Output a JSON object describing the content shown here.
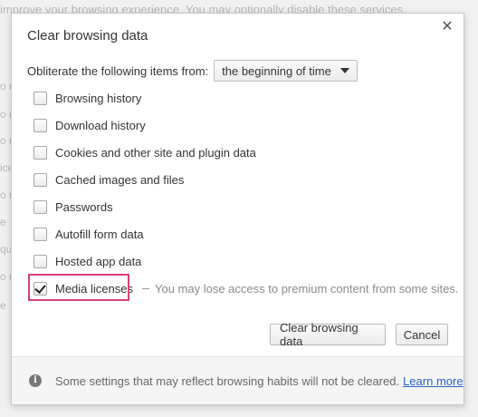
{
  "background": {
    "top_text": "improve your browsing experience. You may optionally disable these services.",
    "fragments": [
      "o r",
      "o r",
      "o r",
      "ice",
      "o r",
      "e",
      "qu",
      "o r",
      "e"
    ]
  },
  "dialog": {
    "title": "Clear browsing data",
    "close_icon": "close-icon",
    "timerange": {
      "label": "Obliterate the following items from:",
      "selected": "the beginning of time"
    },
    "items": [
      {
        "label": "Browsing history",
        "checked": false
      },
      {
        "label": "Download history",
        "checked": false
      },
      {
        "label": "Cookies and other site and plugin data",
        "checked": false
      },
      {
        "label": "Cached images and files",
        "checked": false
      },
      {
        "label": "Passwords",
        "checked": false
      },
      {
        "label": "Autofill form data",
        "checked": false
      },
      {
        "label": "Hosted app data",
        "checked": false
      },
      {
        "label": "Media licenses",
        "checked": true
      }
    ],
    "media_note": "You may lose access to premium content from some sites.",
    "buttons": {
      "clear": "Clear browsing data",
      "cancel": "Cancel"
    },
    "footer": {
      "info_icon": "info-icon",
      "info_glyph": "i",
      "text": "Some settings that may reflect browsing habits will not be cleared.",
      "link": "Learn more"
    }
  },
  "colors": {
    "highlight": "#d9426e",
    "link": "#2a62c9"
  }
}
